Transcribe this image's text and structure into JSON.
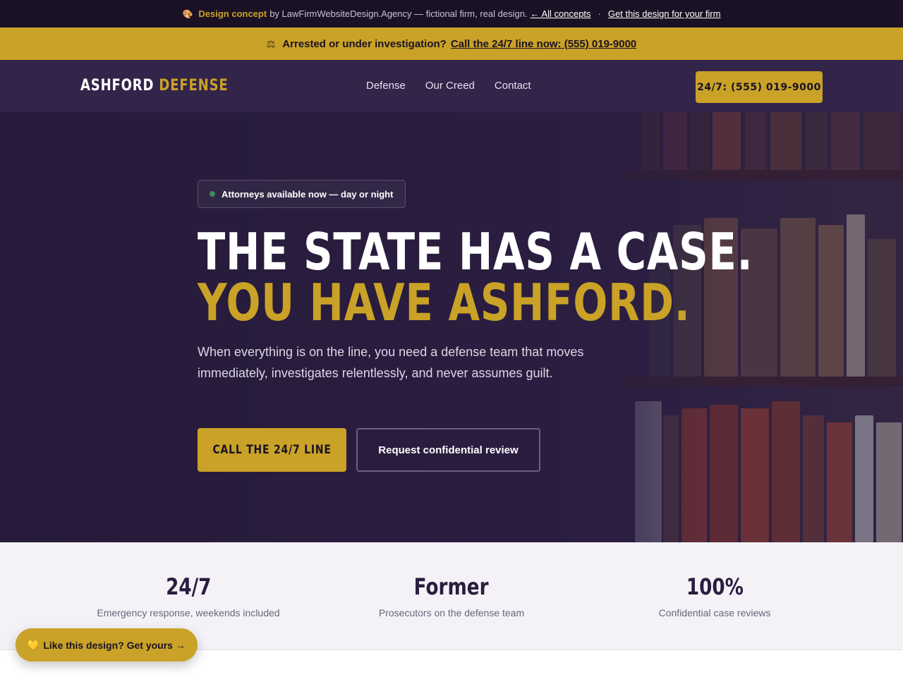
{
  "concept_bar": {
    "icon": "palette-icon",
    "highlight": "Design concept",
    "text": "by LawFirmWebsiteDesign.Agency — fictional firm, real design.",
    "link_all": "← All concepts",
    "separator": "·",
    "link_get": "Get this design for your firm"
  },
  "alert_bar": {
    "icon": "scale-icon",
    "lead": "Arrested or under investigation?",
    "link": "Call the 24/7 line now: (555) 019-9000"
  },
  "nav": {
    "logo_primary": "ASHFORD",
    "logo_accent": "DEFENSE",
    "items": [
      "Defense",
      "Our Creed",
      "Contact"
    ],
    "cta": "24/7: (555) 019-9000"
  },
  "hero": {
    "badge": "Attorneys available now — day or night",
    "headline_line1": "THE STATE HAS A CASE.",
    "headline_line2": "YOU HAVE ASHFORD.",
    "subheading": "When everything is on the line, you need a defense team that moves immediately, investigates relentlessly, and never assumes guilt.",
    "primary_button": "CALL THE 24/7 LINE",
    "secondary_button": "Request confidential review"
  },
  "stats": [
    {
      "value": "24/7",
      "label": "Emergency response, weekends included"
    },
    {
      "value": "Former",
      "label": "Prosecutors on the defense team"
    },
    {
      "value": "100%",
      "label": "Confidential case reviews"
    }
  ],
  "floating_pill": {
    "icon": "heart-icon",
    "label": "Like this design? Get yours →"
  },
  "colors": {
    "brand_gold": "#c9a227",
    "deep_purple": "#2a1d3f",
    "nav_purple": "#33244a",
    "topbar": "#1a1224"
  }
}
